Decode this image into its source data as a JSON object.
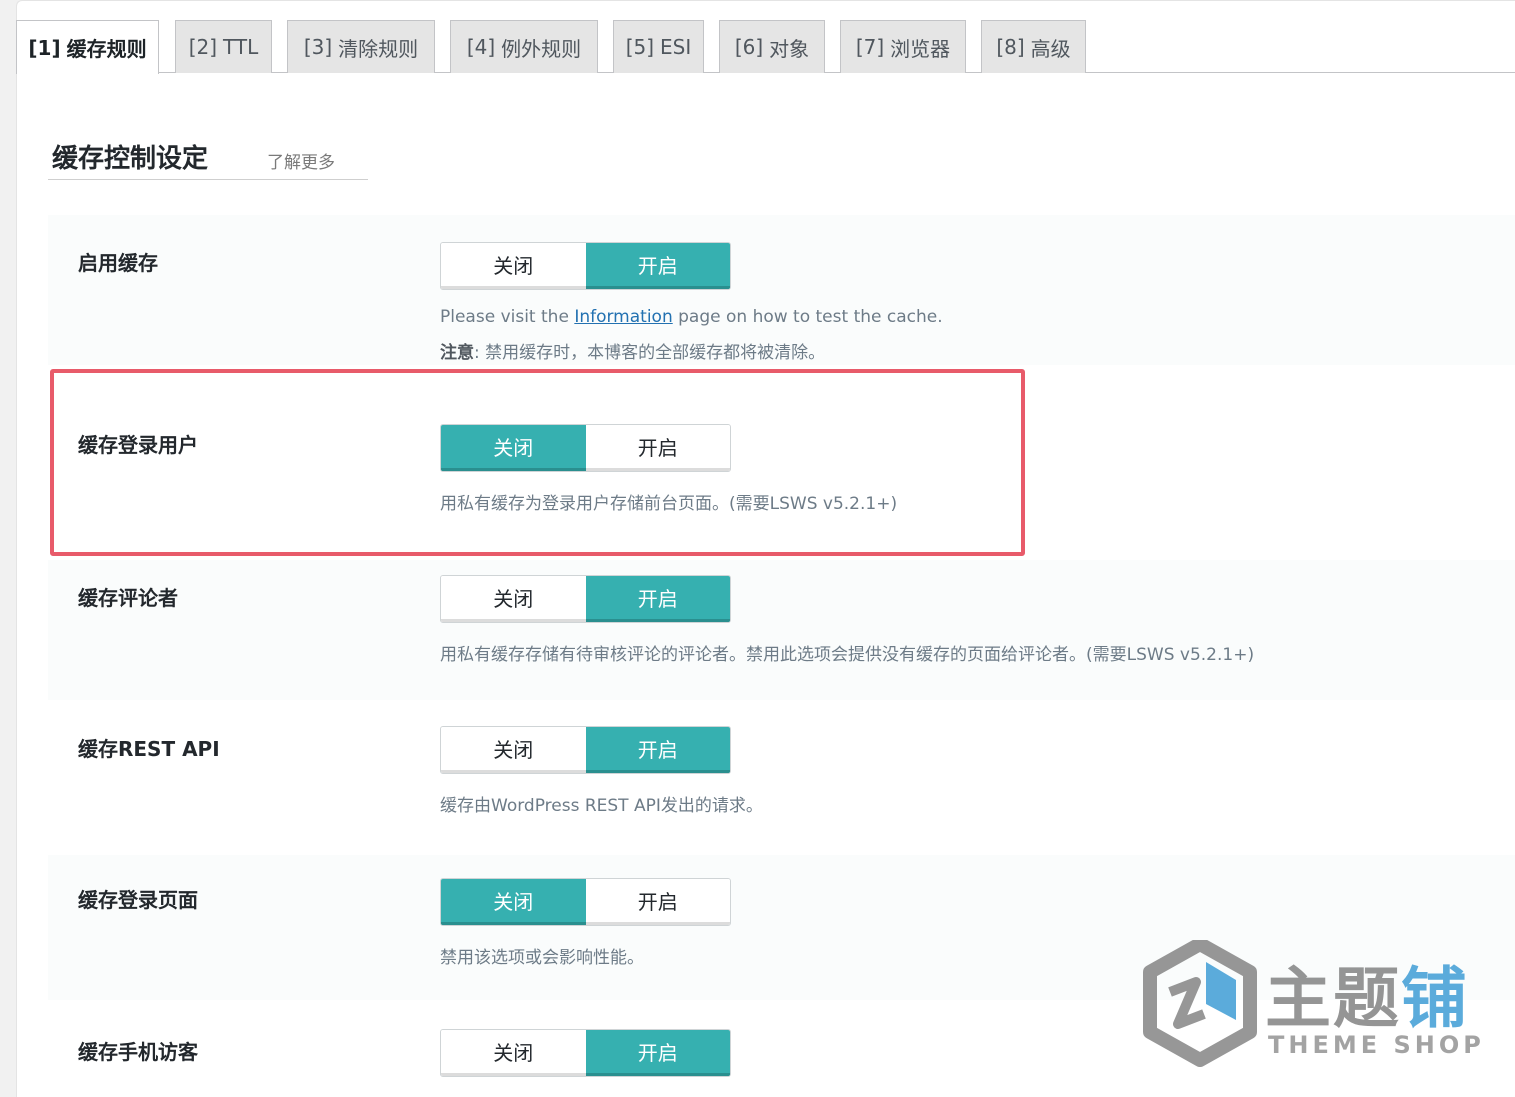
{
  "tabs": [
    {
      "idx": "[1]",
      "label": "缓存规则",
      "active": true
    },
    {
      "idx": "[2]",
      "label": "TTL",
      "active": false
    },
    {
      "idx": "[3]",
      "label": "清除规则",
      "active": false
    },
    {
      "idx": "[4]",
      "label": "例外规则",
      "active": false
    },
    {
      "idx": "[5]",
      "label": "ESI",
      "active": false
    },
    {
      "idx": "[6]",
      "label": "对象",
      "active": false
    },
    {
      "idx": "[7]",
      "label": "浏览器",
      "active": false
    },
    {
      "idx": "[8]",
      "label": "高级",
      "active": false
    }
  ],
  "section": {
    "title": "缓存控制设定",
    "learn_more": "了解更多"
  },
  "toggle_labels": {
    "off": "关闭",
    "on": "开启"
  },
  "settings": [
    {
      "label": "启用缓存",
      "state": "on",
      "desc_prefix": "Please visit the ",
      "desc_link": "Information",
      "desc_suffix": " page on how to test the cache.",
      "note_label": "注意",
      "note_text": ": 禁用缓存时，本博客的全部缓存都将被清除。"
    },
    {
      "label": "缓存登录用户",
      "state": "off",
      "desc": "用私有缓存为登录用户存储前台页面。(需要LSWS v5.2.1+)"
    },
    {
      "label": "缓存评论者",
      "state": "on",
      "desc": "用私有缓存存储有待审核评论的评论者。禁用此选项会提供没有缓存的页面给评论者。(需要LSWS v5.2.1+)"
    },
    {
      "label": "缓存REST API",
      "state": "on",
      "desc": "缓存由WordPress REST API发出的请求。"
    },
    {
      "label": "缓存登录页面",
      "state": "off",
      "desc": "禁用该选项或会影响性能。"
    },
    {
      "label": "缓存手机访客",
      "state": "on"
    }
  ],
  "watermark": {
    "cn_gray": "主题",
    "cn_blue": "铺",
    "en": "THEME SHOP"
  },
  "colors": {
    "accent": "#36b0b0",
    "highlight": "#e85b6a",
    "link": "#2271b1"
  }
}
